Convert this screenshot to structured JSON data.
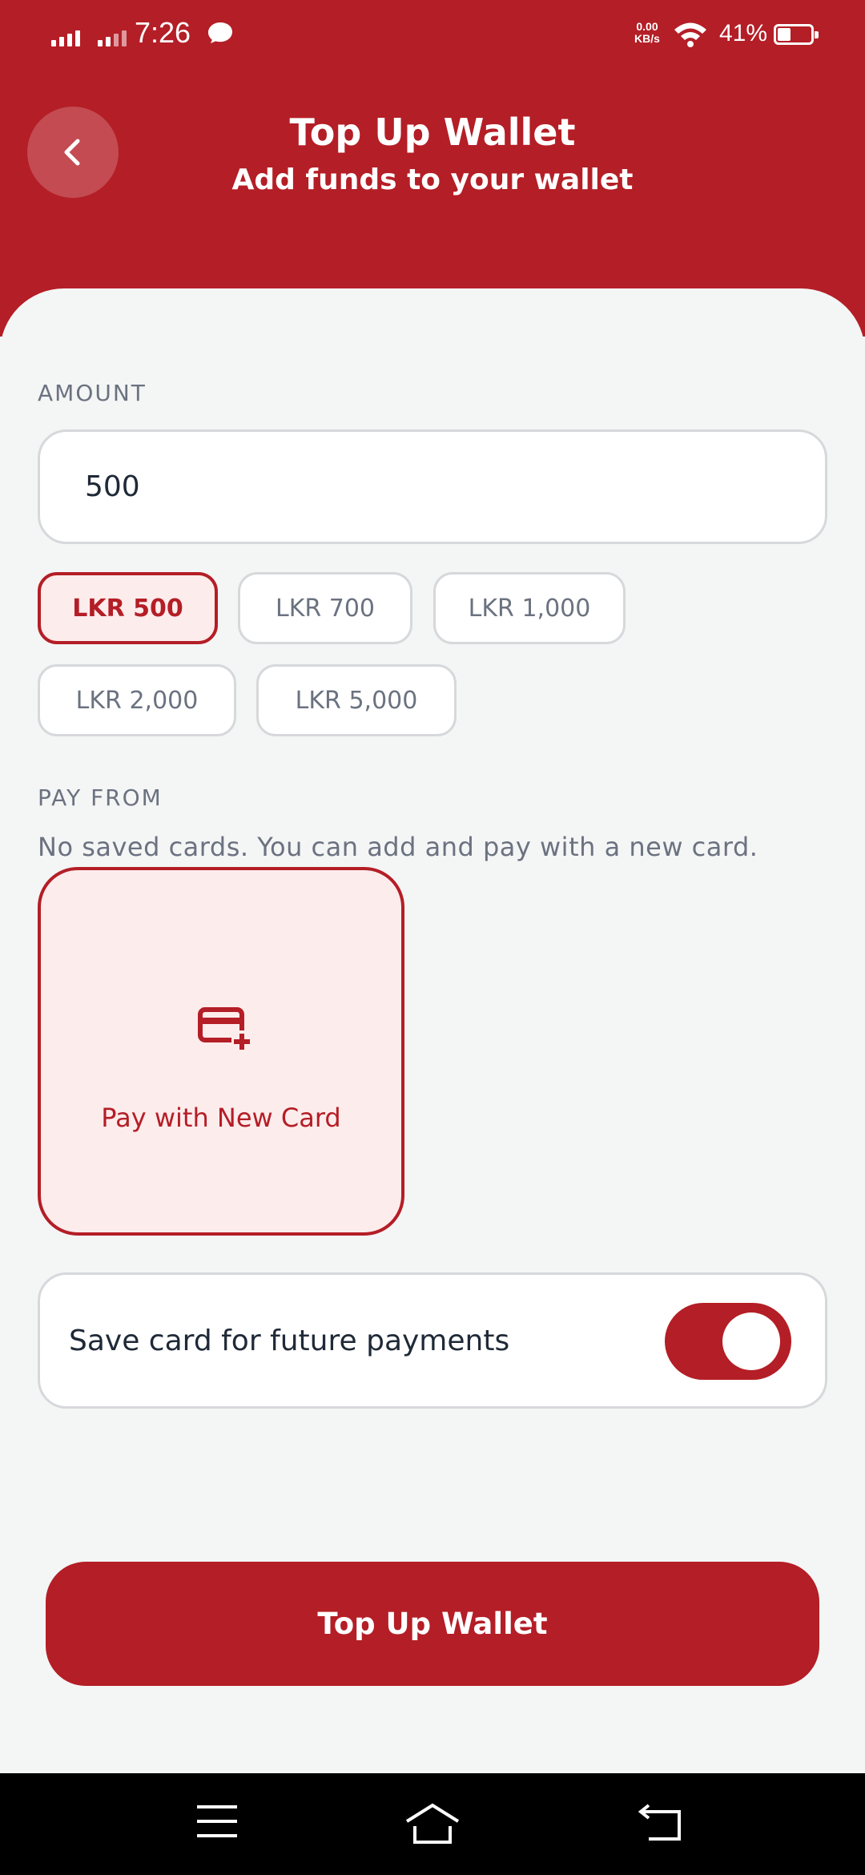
{
  "status_bar": {
    "time": "7:26",
    "net_speed_value": "0.00",
    "net_speed_unit": "KB/s",
    "battery_percent": "41%"
  },
  "header": {
    "title": "Top Up Wallet",
    "subtitle": "Add funds to your wallet",
    "back_icon": "chevron-left-icon"
  },
  "amount": {
    "label": "AMOUNT",
    "value": "500",
    "presets": [
      {
        "label": "LKR 500",
        "selected": true
      },
      {
        "label": "LKR 700",
        "selected": false
      },
      {
        "label": "LKR 1,000",
        "selected": false
      },
      {
        "label": "LKR 2,000",
        "selected": false
      },
      {
        "label": "LKR 5,000",
        "selected": false
      }
    ]
  },
  "pay_from": {
    "label": "PAY FROM",
    "empty_message": "No saved cards. You can add and pay with a new card.",
    "new_card_label": "Pay with New Card",
    "new_card_icon": "credit-card-plus-icon"
  },
  "save_card": {
    "label": "Save card for future payments",
    "enabled": true
  },
  "submit": {
    "label": "Top Up Wallet"
  },
  "colors": {
    "primary": "#b41e26",
    "primary_light": "#fdecec",
    "background": "#f4f5f5"
  }
}
